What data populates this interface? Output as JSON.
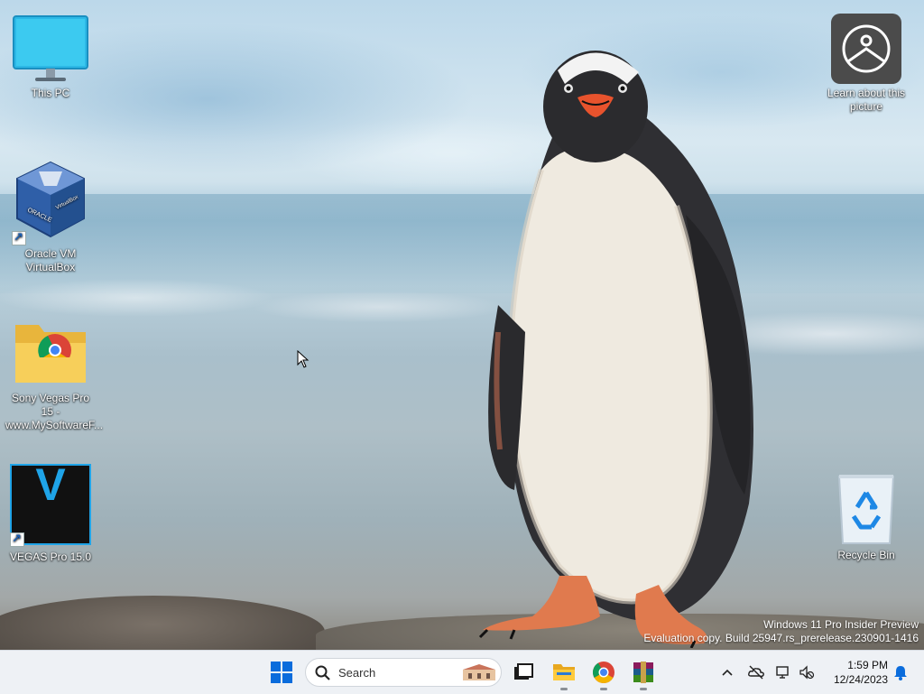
{
  "desktop": {
    "icons": [
      {
        "label": "This PC"
      },
      {
        "label": "Oracle VM VirtualBox"
      },
      {
        "label": "Sony Vegas Pro 15 - www.MySoftwareF..."
      },
      {
        "label": "VEGAS Pro 15.0"
      },
      {
        "label": "Learn about this picture"
      },
      {
        "label": "Recycle Bin"
      }
    ],
    "vegas_letter": "V"
  },
  "watermark": {
    "line1": "Windows 11 Pro Insider Preview",
    "line2": "Evaluation copy. Build 25947.rs_prerelease.230901-1416"
  },
  "taskbar": {
    "search_label": "Search",
    "apps": [
      "task-view",
      "file-explorer",
      "chrome",
      "winrar"
    ],
    "clock": {
      "time": "1:59 PM",
      "date": "12/24/2023"
    }
  },
  "colors": {
    "accent": "#0a6cdc",
    "taskbar_bg": "#eef1f5",
    "vegas_blue": "#1fa4e8"
  }
}
